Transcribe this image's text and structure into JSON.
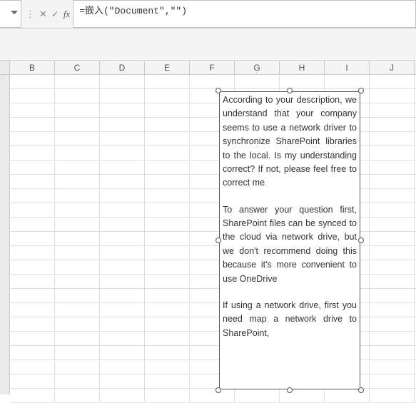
{
  "formula_bar": {
    "fx_label": "fx",
    "formula": "=嵌入(\"Document\",\"\")"
  },
  "columns": [
    "B",
    "C",
    "D",
    "E",
    "F",
    "G",
    "H",
    "I",
    "J"
  ],
  "embedded_doc": {
    "paragraphs": [
      "According to your description, we understand that your company seems to use a network driver to synchronize SharePoint libraries to the local. Is my understanding correct? If not, please feel free to correct me",
      "To answer your question first, SharePoint files can be synced to the cloud via network drive, but we don't recommend doing this because it's more convenient to use OneDrive",
      "If using a network drive, first you need map a network drive to SharePoint,"
    ]
  }
}
